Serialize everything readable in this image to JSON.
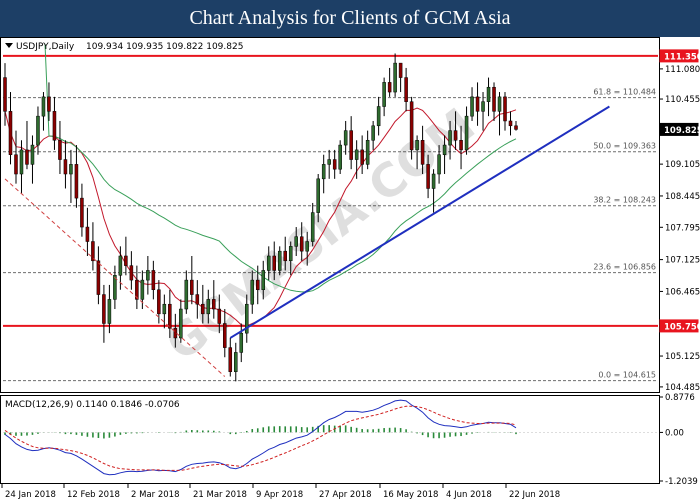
{
  "header": {
    "title": "Chart Analysis for Clients of GCM Asia"
  },
  "price_panel": {
    "symbol_label": "USDJPY,Daily",
    "ohlc_label": "109.934 109.935 109.822 109.825",
    "current_price": "109.825",
    "axis_ticks": [
      {
        "label": "111.080",
        "value": 111.08
      },
      {
        "label": "110.455",
        "value": 110.455
      },
      {
        "label": "109.105",
        "value": 109.105
      },
      {
        "label": "108.445",
        "value": 108.445
      },
      {
        "label": "107.795",
        "value": 107.795
      },
      {
        "label": "107.125",
        "value": 107.125
      },
      {
        "label": "106.465",
        "value": 106.465
      },
      {
        "label": "105.125",
        "value": 105.125
      },
      {
        "label": "104.485",
        "value": 104.485
      }
    ],
    "horizontal_levels": [
      {
        "label": "111.350",
        "value": 111.35,
        "color": "#e8141e"
      },
      {
        "label": "105.750",
        "value": 105.75,
        "color": "#e8141e"
      }
    ],
    "fibonacci": [
      {
        "label": "61.8 = 110.484",
        "value": 110.484
      },
      {
        "label": "50.0 = 109.363",
        "value": 109.363
      },
      {
        "label": "38.2 = 108.243",
        "value": 108.243
      },
      {
        "label": "23.6 = 106.856",
        "value": 106.856
      },
      {
        "label": "0.0 = 104.615",
        "value": 104.615
      }
    ],
    "watermark": "GCMASIA.COM"
  },
  "macd_panel": {
    "label": "MACD(12,26,9) 0.1140 0.1846 -0.0706",
    "axis_ticks": [
      {
        "label": "0.8776",
        "value": 0.8776
      },
      {
        "label": "0.00",
        "value": 0
      },
      {
        "label": "-1.2039",
        "value": -1.2039
      }
    ]
  },
  "x_axis": {
    "labels": [
      "24 Jan 2018",
      "12 Feb 2018",
      "2 Mar 2018",
      "21 Mar 2018",
      "9 Apr 2018",
      "27 Apr 2018",
      "16 May 2018",
      "4 Jun 2018",
      "22 Jun 2018"
    ]
  },
  "chart_data": {
    "type": "candlestick",
    "symbol": "USDJPY",
    "timeframe": "Daily",
    "y_range": [
      104.4,
      111.7
    ],
    "candles": [
      [
        110.9,
        111.2,
        109.9,
        110.2
      ],
      [
        110.2,
        110.6,
        109.1,
        109.3
      ],
      [
        109.3,
        109.8,
        108.7,
        108.9
      ],
      [
        108.9,
        109.6,
        108.5,
        109.4
      ],
      [
        109.4,
        110.0,
        109.0,
        109.1
      ],
      [
        109.1,
        109.7,
        108.7,
        109.5
      ],
      [
        109.5,
        110.3,
        109.3,
        110.1
      ],
      [
        110.1,
        110.6,
        109.8,
        110.5
      ],
      [
        110.5,
        110.8,
        110.0,
        110.2
      ],
      [
        110.2,
        110.5,
        109.4,
        109.6
      ],
      [
        109.6,
        110.0,
        108.9,
        109.2
      ],
      [
        109.2,
        109.6,
        108.6,
        108.9
      ],
      [
        108.9,
        109.4,
        108.3,
        109.1
      ],
      [
        109.1,
        109.5,
        108.2,
        108.4
      ],
      [
        108.4,
        108.7,
        107.6,
        107.8
      ],
      [
        107.8,
        108.2,
        107.2,
        107.5
      ],
      [
        107.5,
        107.9,
        106.9,
        107.1
      ],
      [
        107.1,
        107.4,
        106.2,
        106.4
      ],
      [
        106.4,
        106.6,
        105.4,
        105.8
      ],
      [
        105.8,
        106.6,
        105.6,
        106.3
      ],
      [
        106.3,
        107.0,
        106.1,
        106.8
      ],
      [
        106.8,
        107.4,
        106.5,
        107.2
      ],
      [
        107.2,
        107.6,
        106.8,
        107.0
      ],
      [
        107.0,
        107.3,
        106.5,
        106.7
      ],
      [
        106.7,
        107.0,
        106.1,
        106.3
      ],
      [
        106.3,
        106.9,
        106.1,
        106.7
      ],
      [
        106.7,
        107.2,
        106.4,
        106.9
      ],
      [
        106.9,
        107.1,
        106.3,
        106.5
      ],
      [
        106.5,
        106.7,
        105.8,
        106.0
      ],
      [
        106.0,
        106.4,
        105.7,
        106.2
      ],
      [
        106.2,
        106.5,
        105.5,
        105.7
      ],
      [
        105.7,
        106.0,
        105.3,
        105.5
      ],
      [
        105.5,
        106.3,
        105.4,
        106.1
      ],
      [
        106.1,
        106.9,
        106.0,
        106.7
      ],
      [
        106.7,
        107.2,
        106.2,
        106.4
      ],
      [
        106.4,
        106.7,
        105.9,
        106.2
      ],
      [
        106.2,
        106.6,
        105.8,
        106.0
      ],
      [
        106.0,
        106.5,
        105.8,
        106.3
      ],
      [
        106.3,
        106.7,
        105.9,
        106.1
      ],
      [
        106.1,
        106.4,
        105.6,
        105.8
      ],
      [
        105.8,
        106.1,
        105.1,
        105.3
      ],
      [
        105.3,
        105.5,
        104.7,
        104.8
      ],
      [
        104.8,
        105.4,
        104.6,
        105.2
      ],
      [
        105.2,
        105.8,
        105.0,
        105.6
      ],
      [
        105.6,
        106.4,
        105.4,
        106.2
      ],
      [
        106.2,
        106.9,
        106.0,
        106.7
      ],
      [
        106.7,
        107.0,
        106.2,
        106.5
      ],
      [
        106.5,
        107.1,
        106.3,
        106.9
      ],
      [
        106.9,
        107.4,
        106.7,
        107.2
      ],
      [
        107.2,
        107.5,
        106.7,
        106.9
      ],
      [
        106.9,
        107.4,
        106.8,
        107.3
      ],
      [
        107.3,
        107.6,
        106.9,
        107.1
      ],
      [
        107.1,
        107.5,
        106.8,
        107.4
      ],
      [
        107.4,
        107.8,
        107.2,
        107.6
      ],
      [
        107.6,
        107.9,
        107.1,
        107.3
      ],
      [
        107.3,
        107.7,
        107.0,
        107.5
      ],
      [
        107.5,
        108.3,
        107.4,
        108.1
      ],
      [
        108.1,
        108.9,
        107.9,
        108.8
      ],
      [
        108.8,
        109.3,
        108.5,
        109.1
      ],
      [
        109.1,
        109.4,
        108.8,
        109.2
      ],
      [
        109.2,
        109.4,
        108.8,
        109.0
      ],
      [
        109.0,
        109.6,
        108.9,
        109.5
      ],
      [
        109.5,
        110.0,
        109.3,
        109.8
      ],
      [
        109.8,
        110.1,
        109.0,
        109.2
      ],
      [
        109.2,
        109.6,
        108.8,
        109.4
      ],
      [
        109.4,
        109.7,
        108.9,
        109.1
      ],
      [
        109.1,
        109.8,
        109.0,
        109.6
      ],
      [
        109.6,
        110.0,
        109.4,
        109.9
      ],
      [
        109.9,
        110.5,
        109.7,
        110.3
      ],
      [
        110.3,
        110.9,
        110.1,
        110.8
      ],
      [
        110.8,
        111.1,
        110.5,
        110.6
      ],
      [
        110.6,
        111.4,
        110.5,
        111.2
      ],
      [
        111.2,
        111.2,
        110.6,
        110.9
      ],
      [
        110.9,
        111.1,
        110.2,
        110.4
      ],
      [
        110.4,
        110.5,
        109.2,
        109.4
      ],
      [
        109.4,
        109.7,
        109.0,
        109.6
      ],
      [
        109.6,
        109.9,
        108.9,
        109.1
      ],
      [
        109.1,
        109.3,
        108.4,
        108.6
      ],
      [
        108.6,
        109.0,
        108.1,
        108.9
      ],
      [
        108.9,
        109.5,
        108.7,
        109.3
      ],
      [
        109.3,
        109.7,
        108.9,
        109.5
      ],
      [
        109.5,
        110.0,
        109.2,
        109.8
      ],
      [
        109.8,
        110.2,
        109.4,
        109.6
      ],
      [
        109.6,
        109.9,
        109.0,
        109.4
      ],
      [
        109.4,
        110.3,
        109.3,
        110.1
      ],
      [
        110.1,
        110.7,
        110.0,
        110.5
      ],
      [
        110.5,
        110.8,
        109.9,
        110.2
      ],
      [
        110.2,
        110.6,
        109.8,
        110.4
      ],
      [
        110.4,
        110.9,
        110.1,
        110.7
      ],
      [
        110.7,
        110.8,
        110.0,
        110.2
      ],
      [
        110.2,
        110.6,
        109.7,
        110.5
      ],
      [
        110.5,
        110.6,
        109.8,
        110.0
      ],
      [
        110.0,
        110.2,
        109.7,
        109.9
      ],
      [
        109.9,
        110.0,
        109.8,
        109.825
      ]
    ],
    "trendline": {
      "from": {
        "index": 41,
        "price": 105.5
      },
      "to": {
        "index": 110,
        "price": 110.3
      }
    },
    "macd_params": "12,26,9",
    "macd_values": {
      "macd": 0.114,
      "signal": 0.1846,
      "histogram": -0.0706
    },
    "macd_range": [
      -1.2039,
      0.8776
    ],
    "macd_line": [
      -0.05,
      -0.15,
      -0.28,
      -0.36,
      -0.42,
      -0.45,
      -0.44,
      -0.4,
      -0.38,
      -0.4,
      -0.44,
      -0.5,
      -0.52,
      -0.58,
      -0.66,
      -0.75,
      -0.84,
      -0.93,
      -1.02,
      -1.05,
      -1.04,
      -1.0,
      -0.97,
      -0.96,
      -0.97,
      -0.96,
      -0.94,
      -0.93,
      -0.95,
      -0.94,
      -0.95,
      -0.97,
      -0.92,
      -0.84,
      -0.79,
      -0.77,
      -0.76,
      -0.74,
      -0.73,
      -0.75,
      -0.8,
      -0.88,
      -0.9,
      -0.86,
      -0.77,
      -0.66,
      -0.59,
      -0.51,
      -0.42,
      -0.37,
      -0.3,
      -0.26,
      -0.2,
      -0.14,
      -0.11,
      -0.07,
      0.02,
      0.13,
      0.24,
      0.32,
      0.37,
      0.44,
      0.52,
      0.52,
      0.52,
      0.5,
      0.52,
      0.55,
      0.6,
      0.67,
      0.72,
      0.78,
      0.8,
      0.78,
      0.68,
      0.6,
      0.5,
      0.36,
      0.26,
      0.2,
      0.17,
      0.16,
      0.14,
      0.12,
      0.14,
      0.18,
      0.2,
      0.22,
      0.25,
      0.24,
      0.24,
      0.22,
      0.2,
      0.114
    ],
    "signal_line": [
      0.05,
      -0.05,
      -0.14,
      -0.22,
      -0.29,
      -0.35,
      -0.38,
      -0.39,
      -0.39,
      -0.39,
      -0.41,
      -0.43,
      -0.45,
      -0.48,
      -0.52,
      -0.57,
      -0.63,
      -0.7,
      -0.77,
      -0.83,
      -0.87,
      -0.9,
      -0.91,
      -0.92,
      -0.93,
      -0.93,
      -0.93,
      -0.93,
      -0.93,
      -0.94,
      -0.94,
      -0.94,
      -0.94,
      -0.92,
      -0.89,
      -0.86,
      -0.84,
      -0.82,
      -0.8,
      -0.79,
      -0.8,
      -0.81,
      -0.83,
      -0.84,
      -0.83,
      -0.8,
      -0.76,
      -0.72,
      -0.67,
      -0.62,
      -0.56,
      -0.51,
      -0.45,
      -0.39,
      -0.33,
      -0.28,
      -0.21,
      -0.14,
      -0.06,
      0.02,
      0.09,
      0.16,
      0.23,
      0.29,
      0.33,
      0.36,
      0.39,
      0.42,
      0.45,
      0.49,
      0.53,
      0.58,
      0.62,
      0.65,
      0.65,
      0.64,
      0.61,
      0.56,
      0.5,
      0.44,
      0.39,
      0.34,
      0.3,
      0.27,
      0.24,
      0.23,
      0.22,
      0.22,
      0.23,
      0.23,
      0.23,
      0.23,
      0.22,
      0.1846
    ]
  }
}
